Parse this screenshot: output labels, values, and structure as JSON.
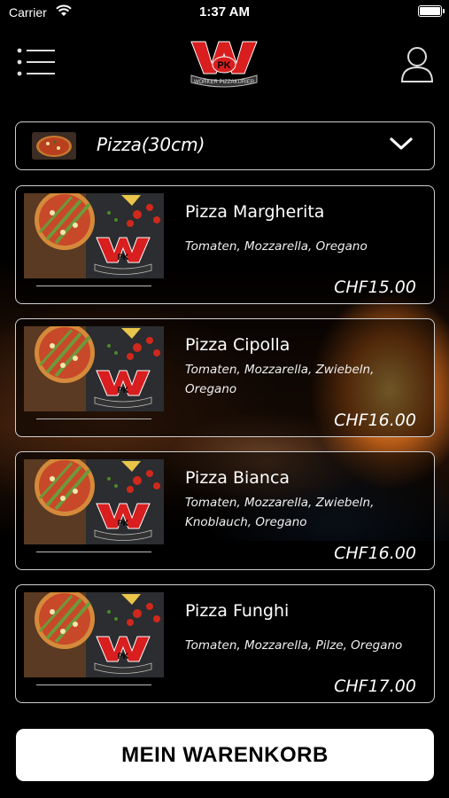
{
  "status_bar": {
    "carrier": "Carrier",
    "time": "1:37 AM"
  },
  "header": {
    "menu_icon": "hamburger-menu-icon",
    "user_icon": "user-profile-icon",
    "logo_letters": "WPK",
    "logo_caption": "WORKER PIZZAKURIER"
  },
  "category": {
    "label": "Pizza(30cm)",
    "icon": "chevron-down-icon"
  },
  "products": [
    {
      "name": "Pizza Margherita",
      "description": "Tomaten, Mozzarella, Oregano",
      "price": "CHF15.00"
    },
    {
      "name": "Pizza Cipolla",
      "description": "Tomaten, Mozzarella, Zwiebeln, Oregano",
      "price": "CHF16.00"
    },
    {
      "name": "Pizza Bianca",
      "description": "Tomaten, Mozzarella, Zwiebeln, Knoblauch, Oregano",
      "price": "CHF16.00"
    },
    {
      "name": "Pizza Funghi",
      "description": "Tomaten, Mozzarella, Pilze, Oregano",
      "price": "CHF17.00"
    }
  ],
  "cart_button": {
    "label": "MEIN WARENKORB"
  },
  "colors": {
    "background": "#000000",
    "brand_red": "#d81e1e",
    "border": "#cfcfcf"
  }
}
